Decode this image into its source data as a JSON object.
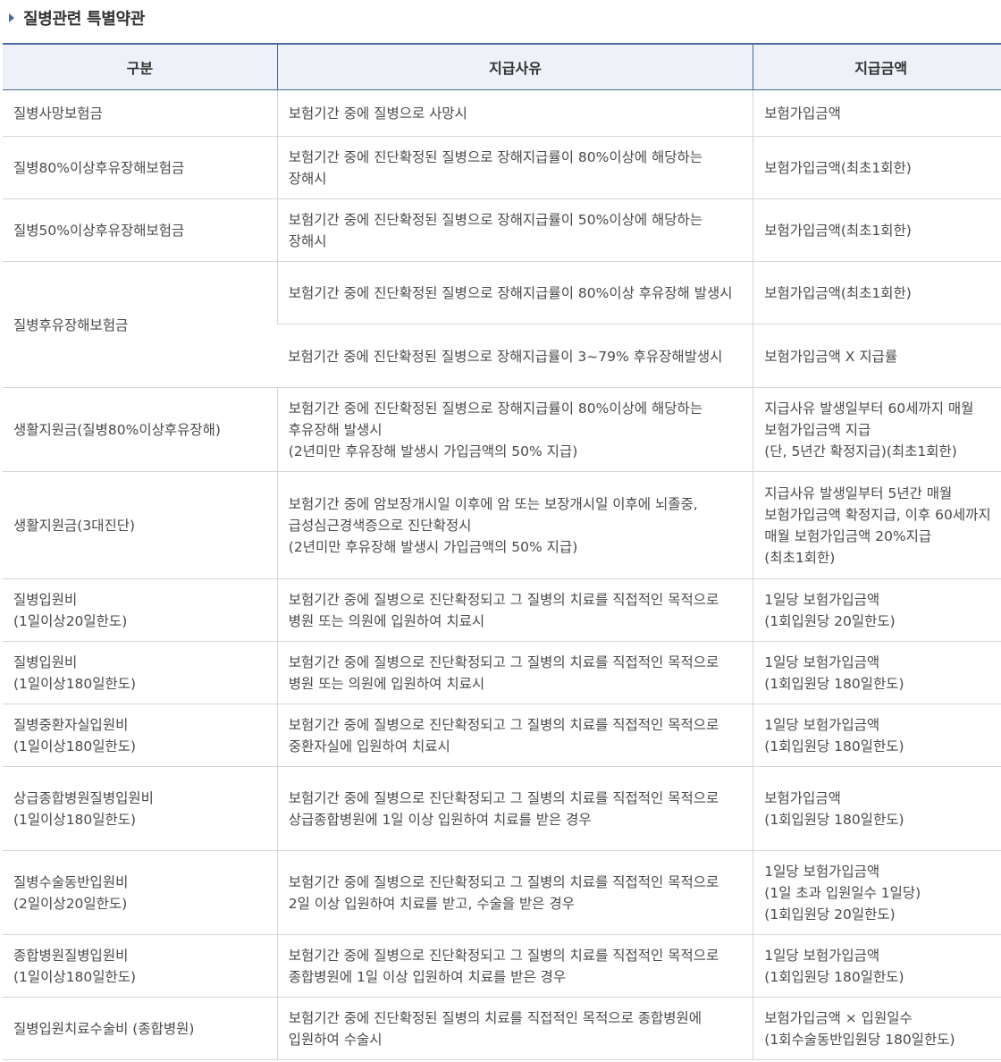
{
  "section": {
    "title": "질병관련 특별약관"
  },
  "table": {
    "headers": [
      "구분",
      "지급사유",
      "지급금액"
    ],
    "rows": [
      {
        "category": "질병사망보험금",
        "reason": "보험기간 중에 질병으로 사망시",
        "amount": "보험가입금액"
      },
      {
        "category": "질병80%이상후유장해보험금",
        "reason": "보험기간 중에 진단확정된 질병으로 장해지급률이 80%이상에 해당하는 장해시",
        "amount": "보험가입금액(최초1회한)"
      },
      {
        "category": "질병50%이상후유장해보험금",
        "reason": "보험기간 중에 진단확정된 질병으로 장해지급률이 50%이상에 해당하는 장해시",
        "amount": "보험가입금액(최초1회한)"
      },
      {
        "category": "질병후유장해보험금",
        "reason": "보험기간 중에 진단확정된 질병으로 장해지급률이 80%이상 후유장해 발생시",
        "amount": "보험가입금액(최초1회한)"
      },
      {
        "reason": "보험기간 중에 진단확정된 질병으로 장해지급률이 3~79% 후유장해발생시",
        "amount": "보험가입금액 X 지급률"
      },
      {
        "category": "생활지원금(질병80%이상후유장해)",
        "reason": "보험기간 중에 진단확정된 질병으로 장해지급률이 80%이상에 해당하는 후유장해 발생시\n(2년미만 후유장해 발생시 가입금액의 50% 지급)",
        "amount": "지급사유 발생일부터 60세까지 매월 보험가입금액 지급\n(단, 5년간 확정지급)(최초1회한)"
      },
      {
        "category": "생활지원금(3대진단)",
        "reason": "보험기간 중에 암보장개시일 이후에 암 또는 보장개시일 이후에 뇌졸중, 급성심근경색증으로 진단확정시\n(2년미만 후유장해 발생시 가입금액의 50% 지급)",
        "amount": "지급사유 발생일부터 5년간 매월 보험가입금액 확정지급, 이후 60세까지 매월 보험가입금액 20%지급(최초1회한)"
      },
      {
        "category": "질병입원비\n(1일이상20일한도)",
        "reason": "보험기간 중에 질병으로 진단확정되고 그 질병의 치료를 직접적인 목적으로 병원 또는 의원에 입원하여 치료시",
        "amount": "1일당 보험가입금액\n(1회입원당 20일한도)"
      },
      {
        "category": "질병입원비\n(1일이상180일한도)",
        "reason": "보험기간 중에 질병으로 진단확정되고 그 질병의 치료를 직접적인 목적으로 병원 또는 의원에 입원하여 치료시",
        "amount": "1일당 보험가입금액\n(1회입원당 180일한도)"
      },
      {
        "category": "질병중환자실입원비\n(1일이상180일한도)",
        "reason": "보험기간 중에 질병으로 진단확정되고 그 질병의 치료를 직접적인 목적으로 중환자실에 입원하여 치료시",
        "amount": "1일당 보험가입금액\n(1회입원당 180일한도)"
      },
      {
        "category": "상급종합병원질병입원비\n(1일이상180일한도)",
        "reason": "보험기간 중에 질병으로 진단확정되고 그 질병의 치료를 직접적인 목적으로 상급종합병원에 1일 이상 입원하여 치료를 받은 경우",
        "amount": "보험가입금액\n(1회입원당 180일한도)"
      },
      {
        "category": "질병수술동반입원비\n(2일이상20일한도)",
        "reason": "보험기간 중에 질병으로 진단확정되고 그 질병의 치료를 직접적인 목적으로 2일 이상 입원하여 치료를 받고, 수술을 받은 경우",
        "amount": "1일당 보험가입금액\n(1일 초과 입원일수 1일당)\n(1회입원당 20일한도)"
      },
      {
        "category": "종합병원질병입원비\n(1일이상180일한도)",
        "reason": "보험기간 중에 질병으로 진단확정되고 그 질병의 치료를 직접적인 목적으로 종합병원에 1일 이상 입원하여 치료를 받은 경우",
        "amount": "1일당 보험가입금액\n(1회입원당 180일한도)"
      },
      {
        "category": "질병입원치료수술비 (종합병원)",
        "reason": "보험기간 중에 진단확정된 질병의 치료를 직접적인 목적으로 종합병원에 입원하여 수술시",
        "amount": "보험가입금액 × 입원일수\n(1회수술동반입원당 180일한도)"
      }
    ]
  }
}
